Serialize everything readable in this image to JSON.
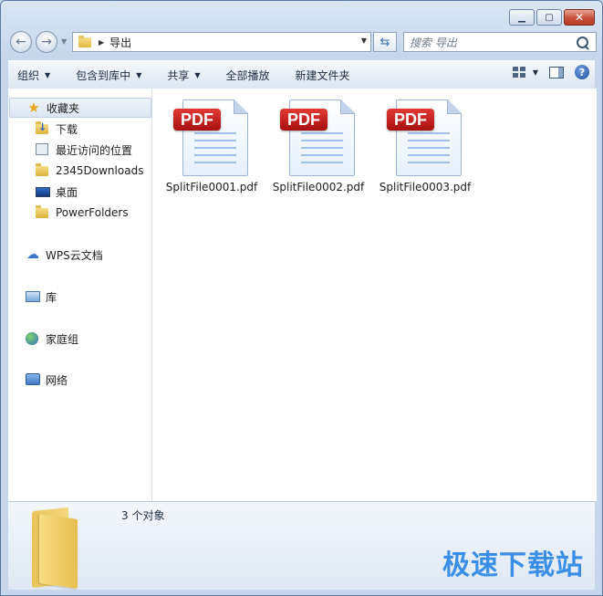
{
  "window": {
    "caption_buttons": [
      "minimize-icon",
      "maximize-icon",
      "close-icon"
    ]
  },
  "address": {
    "path": "导出",
    "search_placeholder": "搜索 导出"
  },
  "toolbar": {
    "organize": "组织",
    "include_in_library": "包含到库中",
    "share": "共享",
    "play_all": "全部播放",
    "new_folder": "新建文件夹"
  },
  "nav": {
    "favorites": "收藏夹",
    "downloads": "下载",
    "recent": "最近访问的位置",
    "downloads_2345": "2345Downloads",
    "desktop": "桌面",
    "powerfolders": "PowerFolders",
    "wps_cloud": "WPS云文档",
    "libraries": "库",
    "homegroup": "家庭组",
    "network": "网络"
  },
  "files": [
    {
      "name": "SplitFile0001.pdf",
      "badge": "PDF"
    },
    {
      "name": "SplitFile0002.pdf",
      "badge": "PDF"
    },
    {
      "name": "SplitFile0003.pdf",
      "badge": "PDF"
    }
  ],
  "details": {
    "count": "3 个对象"
  },
  "watermark": "极速下载站",
  "colors": {
    "accent": "#3a8ee6",
    "pdf_badge": "#c41e1c",
    "window_frame": "#c6d7ec"
  }
}
